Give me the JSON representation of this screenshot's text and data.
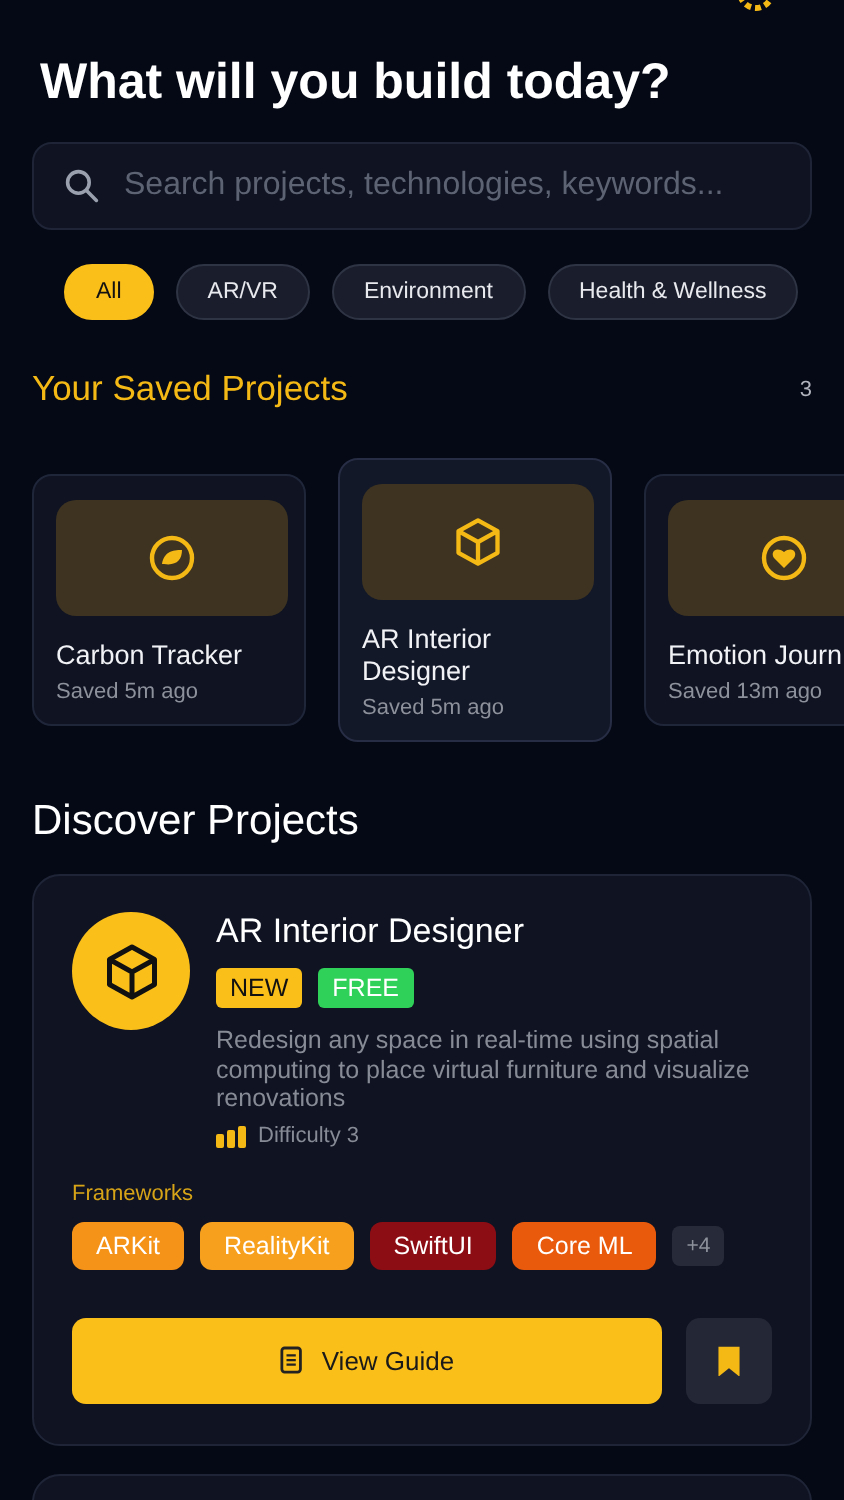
{
  "title": "What will you build today?",
  "search": {
    "placeholder": "Search projects, technologies, keywords..."
  },
  "filters": [
    {
      "label": "All",
      "selected": true
    },
    {
      "label": "AR/VR",
      "selected": false
    },
    {
      "label": "Environment",
      "selected": false
    },
    {
      "label": "Health & Wellness",
      "selected": false
    }
  ],
  "saved": {
    "title": "Your Saved Projects",
    "count": "3",
    "items": [
      {
        "name": "Carbon Tracker",
        "saved": "Saved 5m ago",
        "kind": "leaf",
        "selected": false
      },
      {
        "name": "AR Interior Designer",
        "saved": "Saved 5m ago",
        "kind": "cube",
        "selected": true
      },
      {
        "name": "Emotion Journ",
        "saved": "Saved 13m ago",
        "kind": "heart",
        "selected": false
      }
    ]
  },
  "discover": {
    "title": "Discover Projects",
    "projects": [
      {
        "name": "AR Interior Designer",
        "badges": [
          {
            "label": "NEW",
            "color": "#fbbf1a"
          },
          {
            "label": "FREE",
            "color": "#2fd158"
          }
        ],
        "description": "Redesign any space in real-time using spatial computing to place virtual furniture and visualize renovations",
        "difficulty": "Difficulty 3",
        "frameworks_label": "Frameworks",
        "frameworks": [
          {
            "label": "ARKit",
            "color": "#f59218"
          },
          {
            "label": "RealityKit",
            "color": "#f7a01e"
          },
          {
            "label": "SwiftUI",
            "color": "#8c0d14"
          },
          {
            "label": "Core ML",
            "color": "#ea5a0c"
          }
        ],
        "more": "+4",
        "action": "View Guide",
        "bookmarked": true
      }
    ]
  }
}
